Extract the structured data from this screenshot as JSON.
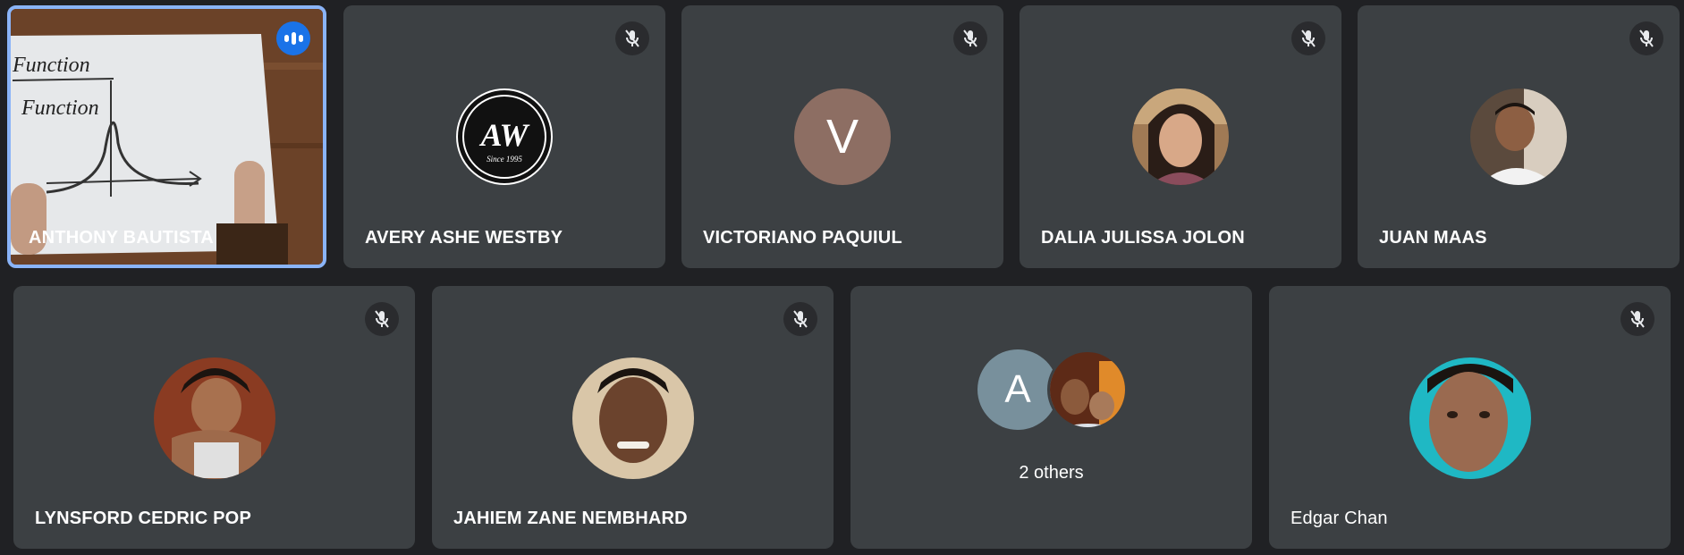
{
  "participants_row1": [
    {
      "name": "ANTHONY BAUTISTA",
      "status": "speaking",
      "avatar_type": "video"
    },
    {
      "name": "AVERY ASHE WESTBY",
      "status": "muted",
      "avatar_type": "logo",
      "logo_text": "AW",
      "logo_sub": "Since 1995"
    },
    {
      "name": "VICTORIANO PAQUIUL",
      "status": "muted",
      "avatar_type": "letter",
      "letter": "V",
      "color": "#8d6e63"
    },
    {
      "name": "DALIA JULISSA JOLON",
      "status": "muted",
      "avatar_type": "photo"
    },
    {
      "name": "JUAN MAAS",
      "status": "muted",
      "avatar_type": "photo"
    }
  ],
  "participants_row2": [
    {
      "name": "LYNSFORD CEDRIC POP",
      "status": "muted",
      "avatar_type": "photo"
    },
    {
      "name": "JAHIEM ZANE NEMBHARD",
      "status": "muted",
      "avatar_type": "photo"
    },
    {
      "others_label": "2 others",
      "letter": "A",
      "color": "#78909c"
    },
    {
      "name": "Edgar Chan",
      "status": "muted",
      "avatar_type": "photo"
    }
  ],
  "video_sketch": {
    "line1": "Function",
    "line2": "Function"
  },
  "colors": {
    "background": "#202124",
    "tile": "#3c4043",
    "active_border": "#8ab4f8",
    "speaking": "#1a73e8"
  }
}
